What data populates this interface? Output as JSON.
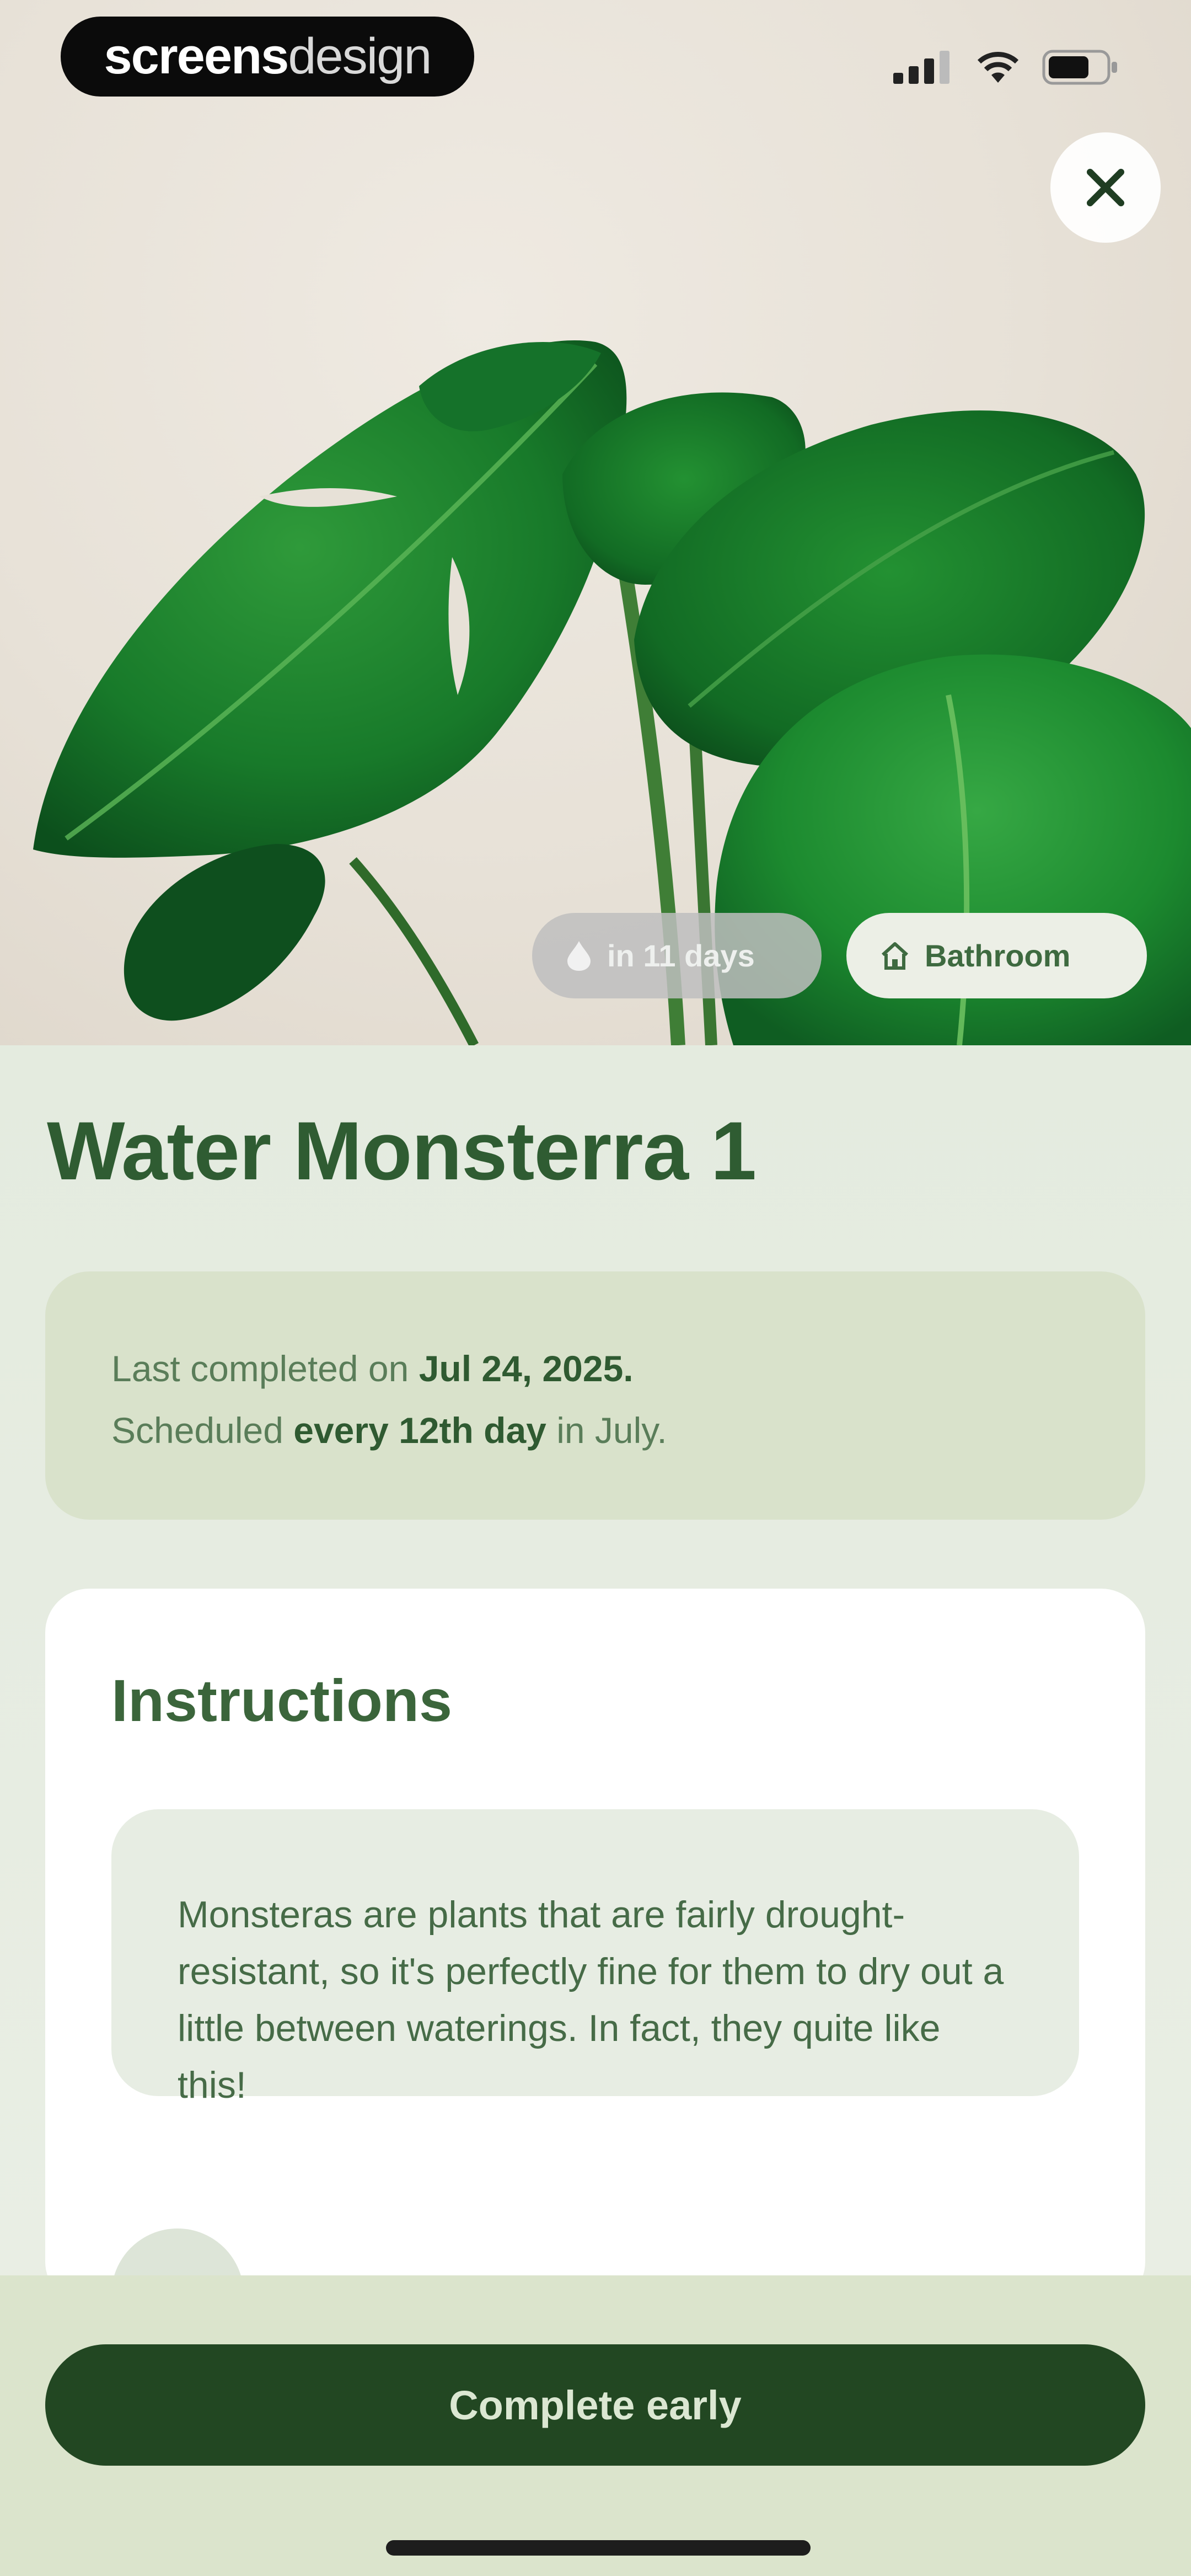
{
  "brand": {
    "name_bold": "screens",
    "name_light": "design"
  },
  "status_bar": {
    "icons": [
      "cellular-signal-icon",
      "wifi-icon",
      "battery-icon"
    ]
  },
  "header": {
    "close_icon": "close-icon"
  },
  "tags": [
    {
      "label": "in 11 days",
      "icon": "water-drop-icon"
    },
    {
      "label": "Bathroom",
      "icon": "home-icon"
    }
  ],
  "task": {
    "title": "Water Monsterra 1",
    "schedule": {
      "line1_prefix": "Last completed on ",
      "line1_date": "Jul 24, 2025.",
      "line2_prefix": "Scheduled ",
      "line2_freq": "every 12th day",
      "line2_suffix": " in July."
    }
  },
  "instructions": {
    "heading": "Instructions",
    "text": "Monsteras are plants that are fairly drought-resistant, so it's perfectly fine for them to dry out a little between waterings. In fact, they quite like this!"
  },
  "actions": {
    "complete_label": "Complete early"
  },
  "colors": {
    "accent_dark_green": "#224722",
    "title_green": "#2f5c32",
    "schedule_bg": "#d9e2cb"
  }
}
